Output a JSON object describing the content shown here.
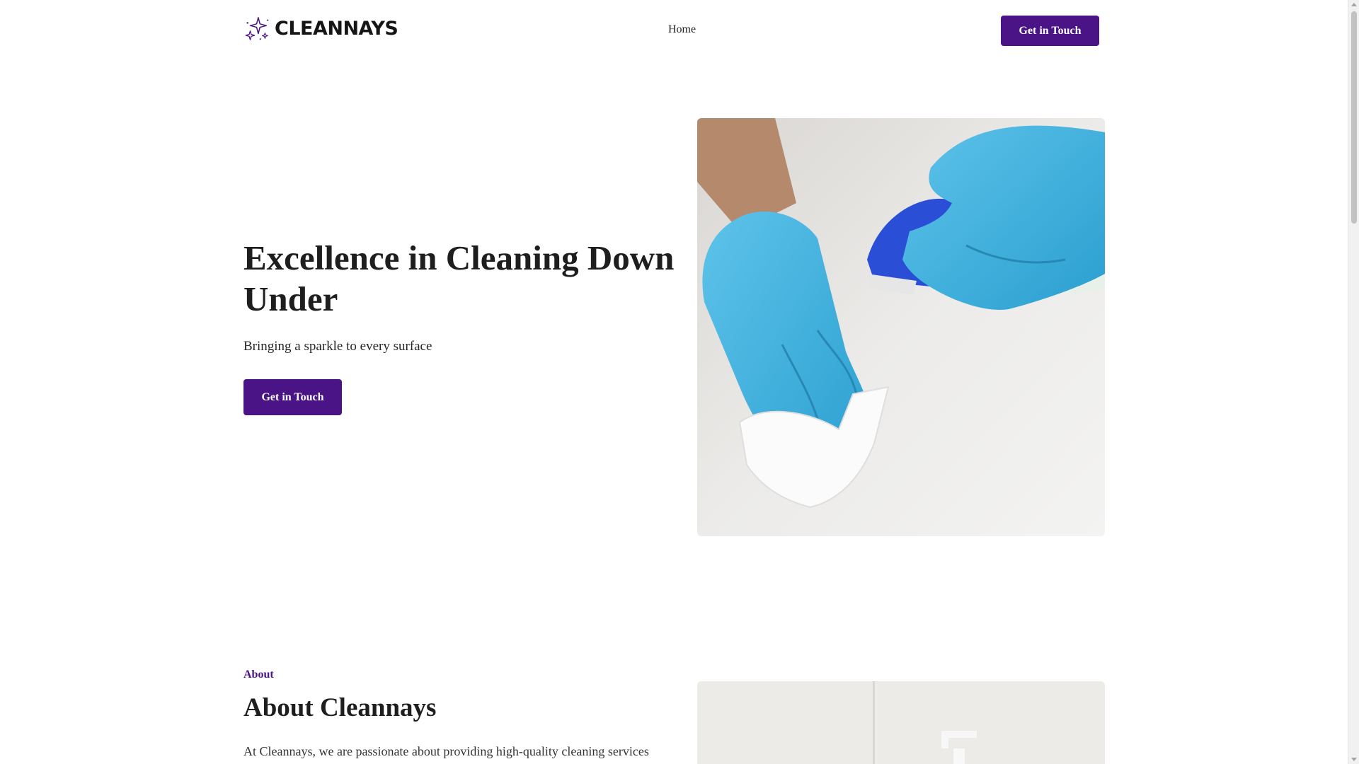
{
  "brand": {
    "name": "CLEANNAYS",
    "logo_icon": "sparkles-icon",
    "accent_color": "#4a1486"
  },
  "nav": {
    "home_label": "Home",
    "cta_label": "Get in Touch"
  },
  "hero": {
    "title": "Excellence in Cleaning Down Under",
    "subtitle": "Bringing a sparkle to every surface",
    "cta_label": "Get in Touch"
  },
  "about": {
    "eyebrow": "About",
    "title": "About Cleannays",
    "text": "At Cleannays, we are passionate about providing high-quality cleaning services"
  }
}
